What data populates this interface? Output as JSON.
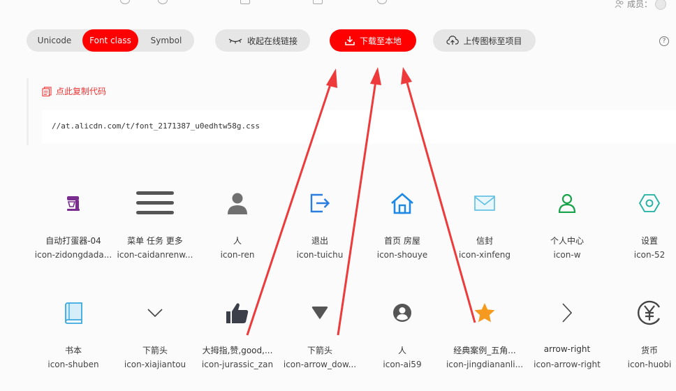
{
  "header": {
    "member_label": "成员："
  },
  "tabs": [
    {
      "label": "Unicode",
      "active": false
    },
    {
      "label": "Font class",
      "active": true
    },
    {
      "label": "Symbol",
      "active": false
    }
  ],
  "toolbar": {
    "collapse_label": "收起在线链接",
    "download_label": "下载至本地",
    "upload_label": "上传图标至项目",
    "help_label": "?"
  },
  "code": {
    "copy_label": "点此复制代码",
    "url": "//at.alicdn.com/t/font_2171387_u0edhtw58g.css"
  },
  "colors": {
    "accent": "#ff0000",
    "arrow": "#ee3a3a"
  },
  "icons_row1": [
    {
      "name": "自动打蛋器-04",
      "code": "icon-zidongdada...",
      "icon": "mixer-icon"
    },
    {
      "name": "菜单 任务 更多",
      "code": "icon-caidanrenw...",
      "icon": "menu-icon"
    },
    {
      "name": "人",
      "code": "icon-ren",
      "icon": "person-icon"
    },
    {
      "name": "退出",
      "code": "icon-tuichu",
      "icon": "logout-icon"
    },
    {
      "name": "首页 房屋",
      "code": "icon-shouye",
      "icon": "home-icon"
    },
    {
      "name": "信封",
      "code": "icon-xinfeng",
      "icon": "envelope-icon"
    },
    {
      "name": "个人中心",
      "code": "icon-w",
      "icon": "user-outline-icon"
    },
    {
      "name": "设置",
      "code": "icon-52",
      "icon": "settings-hexagon-icon"
    }
  ],
  "icons_row2": [
    {
      "name": "书本",
      "code": "icon-shuben",
      "icon": "book-icon"
    },
    {
      "name": "下箭头",
      "code": "icon-xiajiantou",
      "icon": "chevron-down-icon"
    },
    {
      "name": "大拇指,赞,good,...",
      "code": "icon-jurassic_zan",
      "icon": "thumbs-up-icon"
    },
    {
      "name": "下箭头",
      "code": "icon-arrow_dow...",
      "icon": "triangle-down-icon"
    },
    {
      "name": "人",
      "code": "icon-ai59",
      "icon": "user-circle-icon"
    },
    {
      "name": "经典案例_五角...",
      "code": "icon-jingdiananli...",
      "icon": "star-icon"
    },
    {
      "name": "arrow-right",
      "code": "icon-arrow-right",
      "icon": "chevron-right-icon"
    },
    {
      "name": "货币",
      "code": "icon-huobi",
      "icon": "yuan-currency-icon"
    }
  ]
}
